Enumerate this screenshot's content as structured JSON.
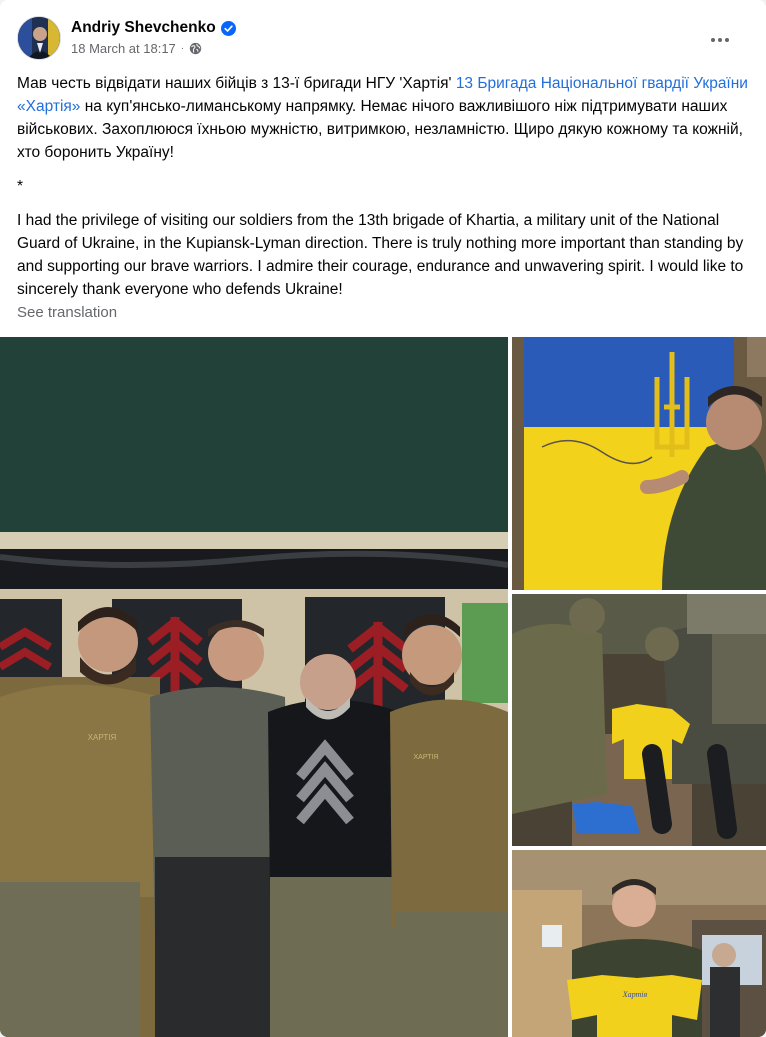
{
  "post": {
    "author": "Andriy Shevchenko",
    "verified_icon": "verified-badge-icon",
    "date": "18 March at 18:17",
    "separator": "·",
    "privacy_icon": "globe-icon",
    "more_icon": "more-options-icon"
  },
  "body": {
    "ua_part1": "Мав честь відвідати наших бійців з 13-ї бригади НГУ 'Хартія' ",
    "ua_link": "13 Бригада Національної гвардії України «Хартія»",
    "ua_part2": " на куп'янсько-лиманському напрямку. Немає нічого важливішого ніж підтримувати наших військових. Захоплююся їхньою мужністю, витримкою, незламністю. Щиро дякую кожному та кожній, хто боронить Україну!",
    "separator": "*",
    "en": "I had the privilege of visiting our soldiers from the 13th brigade of Khartia, a military unit of the National Guard of Ukraine, in the Kupiansk-Lyman direction. There is truly nothing more important than standing by and supporting our brave warriors. I admire their courage, endurance and unwavering spirit. I would like to sincerely thank everyone who defends Ukraine!"
  },
  "see_translation": "See translation",
  "photos": {
    "shirt_brand": "ХАРТІЯ",
    "jersey_inscription": "Хартія"
  },
  "colors": {
    "link": "#216fdb",
    "secondary_text": "#65676b",
    "verified": "#0866ff",
    "ukraine_blue": "#2a5bb8",
    "ukraine_yellow": "#f3d21b"
  }
}
